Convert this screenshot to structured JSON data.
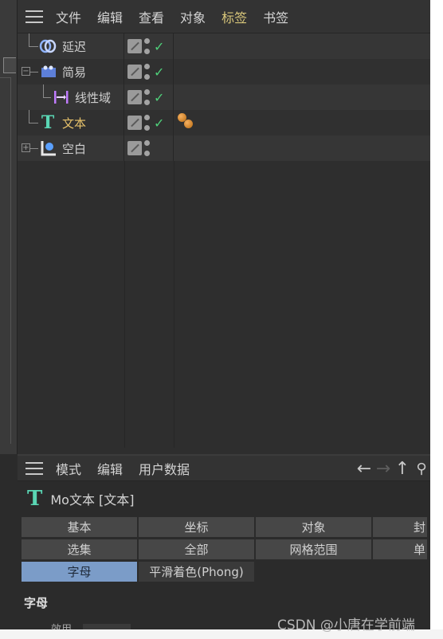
{
  "object_manager": {
    "menu": [
      "文件",
      "编辑",
      "查看",
      "对象",
      "标签",
      "书签"
    ],
    "active_menu_index": 4,
    "objects": [
      {
        "label": "延迟",
        "icon": "delay-effector-icon",
        "expander": "",
        "active": false
      },
      {
        "label": "简易",
        "icon": "plain-effector-icon",
        "expander": "⊟",
        "active": false
      },
      {
        "label": "线性域",
        "icon": "linear-field-icon",
        "expander": "",
        "active": false
      },
      {
        "label": "文本",
        "icon": "text-object-icon",
        "expander": "",
        "active": true
      },
      {
        "label": "空白",
        "icon": "null-object-icon",
        "expander": "⊞",
        "active": false
      }
    ],
    "check_mark": "✓"
  },
  "attribute_manager": {
    "menu": [
      "模式",
      "编辑",
      "用户数据"
    ],
    "object_title": "Mo文本 [文本]",
    "tabs_row1": [
      "基本",
      "坐标",
      "对象",
      "封"
    ],
    "tabs_row2": [
      "选集",
      "全部",
      "网格范围",
      "单"
    ],
    "tabs_row3": [
      "字母",
      "平滑着色(Phong)"
    ],
    "active_tab": "字母",
    "section_title": "字母",
    "param_label": "效用"
  },
  "watermark": "CSDN @小唐在学前端",
  "colors": {
    "active_menu": "#d8c67a",
    "active_object": "#e7c26a",
    "check": "#4fd07a",
    "active_tab": "#7b9cc8",
    "text_icon": "#5ad6b4"
  }
}
